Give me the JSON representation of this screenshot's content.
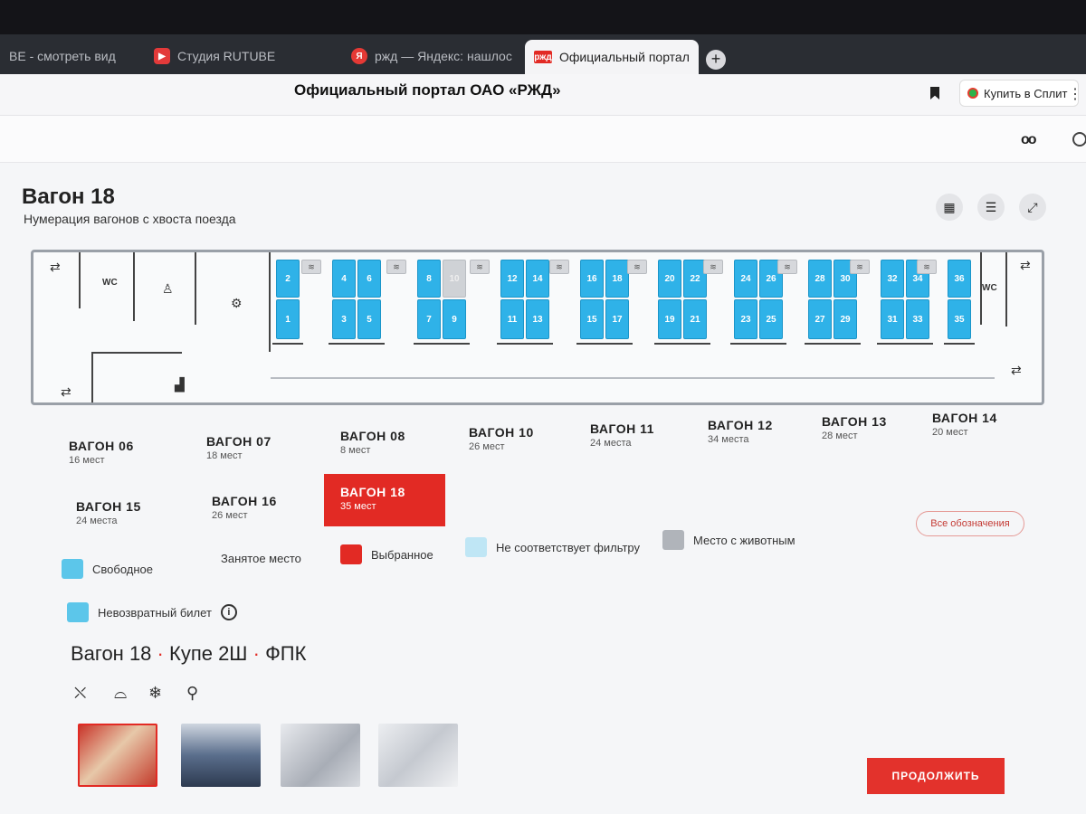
{
  "browser": {
    "tabs": [
      {
        "label": "BE - смотреть вид",
        "icon": "none"
      },
      {
        "label": "Студия RUTUBE",
        "icon": "rutube-icon"
      },
      {
        "label": "ржд — Яндекс: нашлос",
        "icon": "yandex-icon"
      },
      {
        "label": "Официальный портал",
        "icon": "rzd-icon",
        "active": true
      }
    ],
    "close_glyph": "×",
    "newtab_glyph": "+",
    "page_title": "Официальный портал ОАО «РЖД»",
    "split_button": "Купить в Сплит",
    "kebab": "⋮",
    "glasses": "oo"
  },
  "header": {
    "title": "Вагон 18",
    "subtitle": "Нумерация вагонов с хвоста поезда"
  },
  "scheme": {
    "wc_label": "WC",
    "seats": [
      {
        "n": "2",
        "busy": false
      },
      {
        "n": "1",
        "busy": false
      },
      {
        "n": "4",
        "busy": false
      },
      {
        "n": "6",
        "busy": false
      },
      {
        "n": "3",
        "busy": false
      },
      {
        "n": "5",
        "busy": false
      },
      {
        "n": "8",
        "busy": false
      },
      {
        "n": "10",
        "busy": true
      },
      {
        "n": "7",
        "busy": false
      },
      {
        "n": "9",
        "busy": false
      },
      {
        "n": "12",
        "busy": false
      },
      {
        "n": "14",
        "busy": false
      },
      {
        "n": "11",
        "busy": false
      },
      {
        "n": "13",
        "busy": false
      },
      {
        "n": "16",
        "busy": false
      },
      {
        "n": "18",
        "busy": false
      },
      {
        "n": "15",
        "busy": false
      },
      {
        "n": "17",
        "busy": false
      },
      {
        "n": "20",
        "busy": false
      },
      {
        "n": "22",
        "busy": false
      },
      {
        "n": "19",
        "busy": false
      },
      {
        "n": "21",
        "busy": false
      },
      {
        "n": "24",
        "busy": false
      },
      {
        "n": "26",
        "busy": false
      },
      {
        "n": "23",
        "busy": false
      },
      {
        "n": "25",
        "busy": false
      },
      {
        "n": "28",
        "busy": false
      },
      {
        "n": "30",
        "busy": false
      },
      {
        "n": "27",
        "busy": false
      },
      {
        "n": "29",
        "busy": false
      },
      {
        "n": "32",
        "busy": false
      },
      {
        "n": "34",
        "busy": false
      },
      {
        "n": "31",
        "busy": false
      },
      {
        "n": "33",
        "busy": false
      },
      {
        "n": "36",
        "busy": false
      },
      {
        "n": "35",
        "busy": false
      }
    ]
  },
  "cars": [
    {
      "name": "ВАГОН 06",
      "seats": "16 мест"
    },
    {
      "name": "ВАГОН 07",
      "seats": "18 мест"
    },
    {
      "name": "ВАГОН 08",
      "seats": "8 мест"
    },
    {
      "name": "ВАГОН 10",
      "seats": "26 мест"
    },
    {
      "name": "ВАГОН 11",
      "seats": "24 места"
    },
    {
      "name": "ВАГОН 12",
      "seats": "34 места"
    },
    {
      "name": "ВАГОН 13",
      "seats": "28 мест"
    },
    {
      "name": "ВАГОН 14",
      "seats": "20 мест"
    },
    {
      "name": "ВАГОН 15",
      "seats": "24 места"
    },
    {
      "name": "ВАГОН 16",
      "seats": "26 мест"
    },
    {
      "name": "ВАГОН 18",
      "seats": "35 мест",
      "selected": true
    }
  ],
  "all_legend": "Все обозначения",
  "legend": [
    {
      "label": "Свободное",
      "color": "#5cc6ea"
    },
    {
      "label": "Занятое место",
      "color": ""
    },
    {
      "label": "Выбранное",
      "color": "#e22a24"
    },
    {
      "label": "Не соответствует фильтру",
      "color": "#bfe6f5"
    },
    {
      "label": "Место с животным",
      "color": "#b0b4ba"
    },
    {
      "label": "Невозвратный билет",
      "color": "#5cc6ea"
    }
  ],
  "info_glyph": "i",
  "car_info": {
    "car": "Вагон 18",
    "class": "Купе 2Ш",
    "carrier": "ФПК",
    "separator": "·"
  },
  "amenities": [
    "bed-icon",
    "washbasin-icon",
    "snowflake-icon",
    "toilet-icon"
  ],
  "continue_label": "ПРОДОЛЖИТЬ",
  "colors": {
    "accent": "#e22a24",
    "free_seat": "#2fb2e8",
    "busy_seat": "#cfd2d6"
  }
}
